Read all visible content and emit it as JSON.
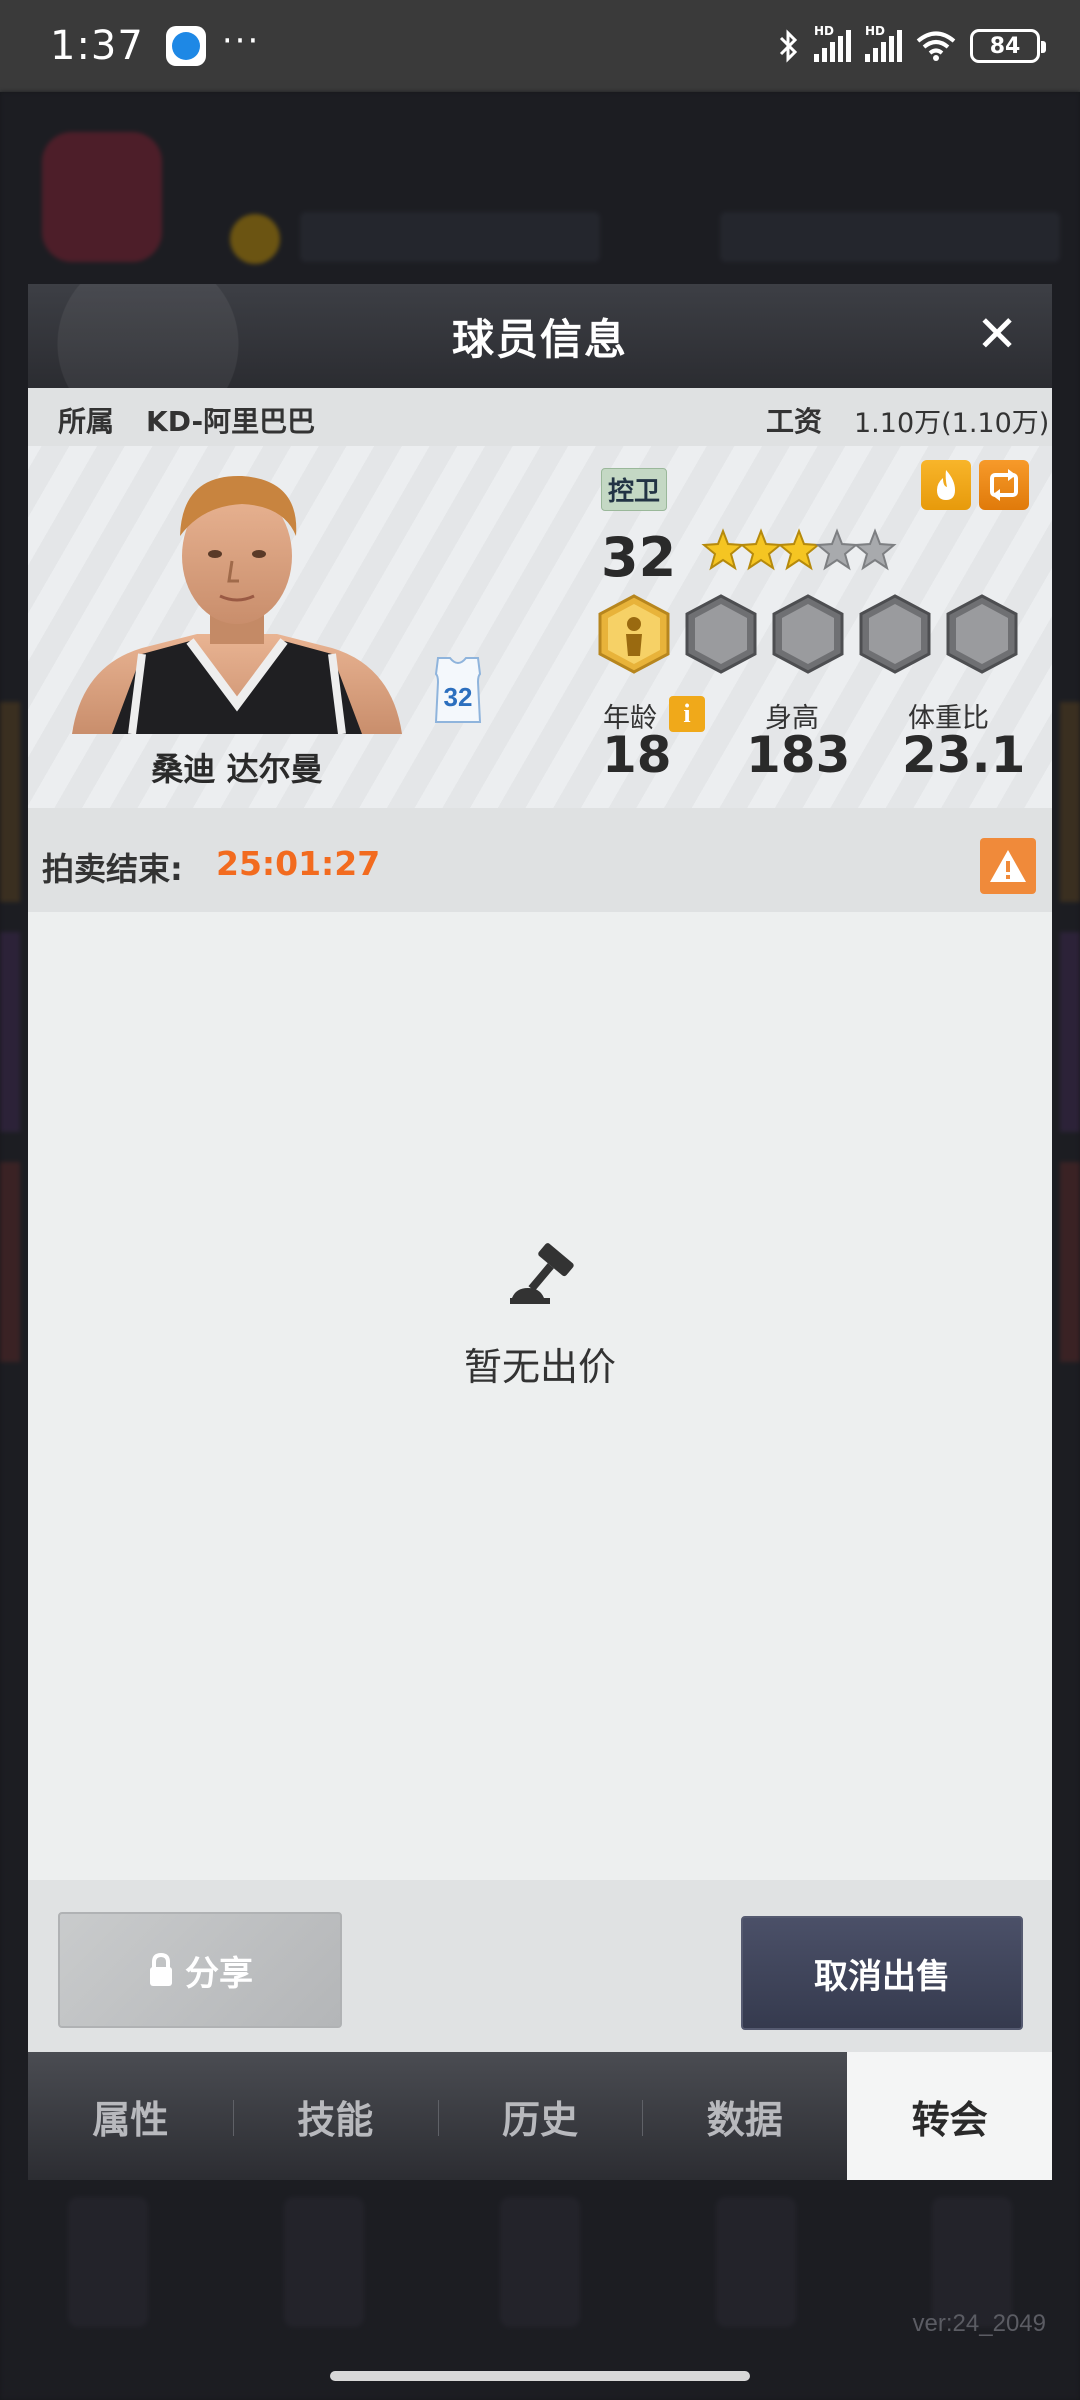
{
  "status_bar": {
    "time": "1:37",
    "more": "···",
    "signal_1": "HD",
    "signal_2": "HD",
    "battery": "84"
  },
  "modal": {
    "title": "球员信息",
    "close": "✕",
    "owner_label": "所属",
    "owner_value": "KD-阿里巴巴",
    "salary_label": "工资",
    "salary_value": "1.10万(1.10万)",
    "player": {
      "name": "桑迪 达尔曼",
      "jersey_number": "32",
      "position": "控卫",
      "rating": "32",
      "stars_filled": 3,
      "stars_total": 5,
      "age_label": "年龄",
      "age": "18",
      "height_label": "身高",
      "height": "183",
      "weight_label": "体重比",
      "weight": "23.1",
      "info_icon": "i"
    },
    "auction_label": "拍卖结束:",
    "auction_time": "25:01:27",
    "empty_text": "暂无出价",
    "share_label": "分享",
    "cancel_label": "取消出售",
    "tabs": [
      {
        "label": "属性",
        "active": false
      },
      {
        "label": "技能",
        "active": false
      },
      {
        "label": "历史",
        "active": false
      },
      {
        "label": "数据",
        "active": false
      },
      {
        "label": "转会",
        "active": true
      }
    ]
  },
  "version": "ver:24_2049",
  "colors": {
    "accent_orange": "#f26b1f",
    "badge_gold": "#f0a91a",
    "header_dark": "#2b2c31",
    "cancel_btn": "#3f4459"
  },
  "icons": [
    "app-icon",
    "bluetooth-icon",
    "signal-icon",
    "wifi-icon",
    "battery-icon",
    "close-icon",
    "jersey-icon",
    "fire-icon",
    "swap-icon",
    "star-icon",
    "skill-badge-icon",
    "info-icon",
    "warning-icon",
    "gavel-icon",
    "lock-icon"
  ]
}
